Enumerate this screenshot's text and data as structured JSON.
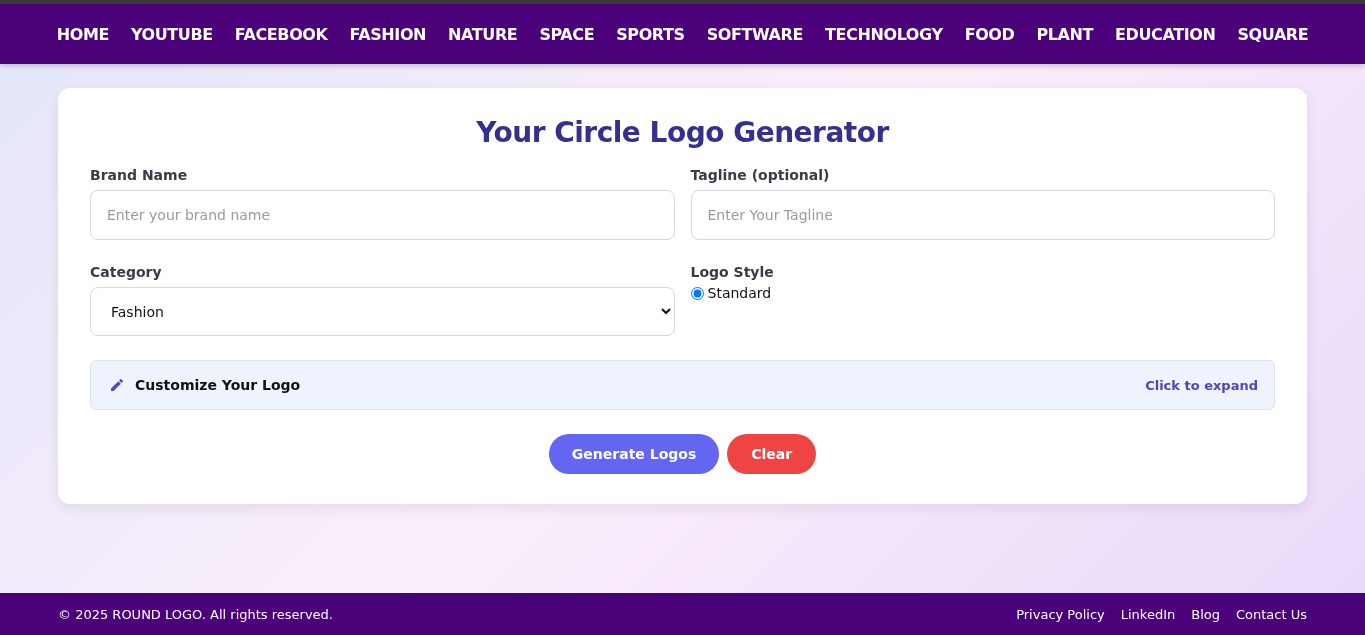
{
  "nav": [
    "HOME",
    "YOUTUBE",
    "FACEBOOK",
    "FASHION",
    "NATURE",
    "SPACE",
    "SPORTS",
    "SOFTWARE",
    "TECHNOLOGY",
    "FOOD",
    "PLANT",
    "EDUCATION",
    "SQUARE"
  ],
  "title": "Your Circle Logo Generator",
  "brand": {
    "label": "Brand Name",
    "placeholder": "Enter your brand name"
  },
  "tagline": {
    "label": "Tagline (optional)",
    "placeholder": "Enter Your Tagline"
  },
  "category": {
    "label": "Category",
    "value": "Fashion"
  },
  "logo_style": {
    "label": "Logo Style",
    "options": [
      {
        "label": "Standard",
        "selected": true
      }
    ]
  },
  "customize": {
    "label": "Customize Your Logo",
    "hint": "Click to expand"
  },
  "buttons": [
    "Generate Logos",
    "Clear"
  ],
  "footer": {
    "copyright": "© 2025 ROUND LOGO. All rights reserved.",
    "links": [
      "Privacy Policy",
      "LinkedIn",
      "Blog",
      "Contact Us"
    ]
  }
}
